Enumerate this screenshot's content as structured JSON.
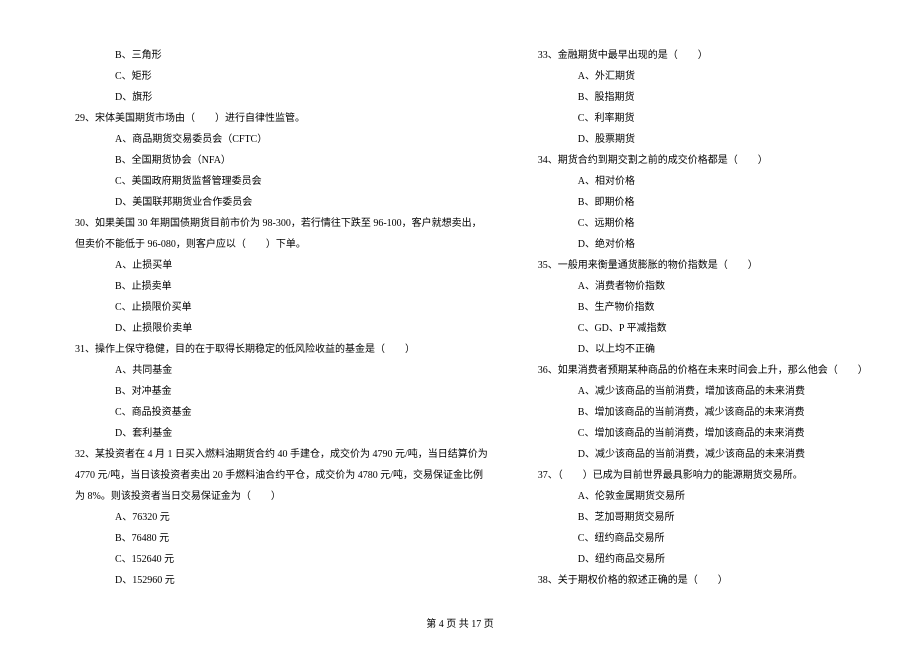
{
  "leftColumn": {
    "q28_options": [
      "B、三角形",
      "C、矩形",
      "D、旗形"
    ],
    "q29": {
      "text": "29、宋体美国期货市场由（　　）进行自律性监管。",
      "options": [
        "A、商品期货交易委员会（CFTC）",
        "B、全国期货协会（NFA）",
        "C、美国政府期货监督管理委员会",
        "D、美国联邦期货业合作委员会"
      ]
    },
    "q30": {
      "line1": "30、如果美国 30 年期国债期货目前市价为 98-300，若行情往下跌至 96-100，客户就想卖出，",
      "line2": "但卖价不能低于 96-080，则客户应以（　　）下单。",
      "options": [
        "A、止损买单",
        "B、止损卖单",
        "C、止损限价买单",
        "D、止损限价卖单"
      ]
    },
    "q31": {
      "text": "31、操作上保守稳健，目的在于取得长期稳定的低风险收益的基金是（　　）",
      "options": [
        "A、共同基金",
        "B、对冲基金",
        "C、商品投资基金",
        "D、套利基金"
      ]
    },
    "q32": {
      "line1": "32、某投资者在 4 月 1 日买入燃料油期货合约 40 手建仓，成交价为 4790 元/吨，当日结算价为",
      "line2": "4770 元/吨，当日该投资者卖出 20 手燃料油合约平仓，成交价为 4780 元/吨，交易保证金比例",
      "line3": "为 8%。则该投资者当日交易保证金为（　　）",
      "options": [
        "A、76320 元",
        "B、76480 元",
        "C、152640 元",
        "D、152960 元"
      ]
    }
  },
  "rightColumn": {
    "q33": {
      "text": "33、金融期货中最早出现的是（　　）",
      "options": [
        "A、外汇期货",
        "B、股指期货",
        "C、利率期货",
        "D、股票期货"
      ]
    },
    "q34": {
      "text": "34、期货合约到期交割之前的成交价格都是（　　）",
      "options": [
        "A、相对价格",
        "B、即期价格",
        "C、远期价格",
        "D、绝对价格"
      ]
    },
    "q35": {
      "text": "35、一般用来衡量通货膨胀的物价指数是（　　）",
      "options": [
        "A、消费者物价指数",
        "B、生产物价指数",
        "C、GD、P 平减指数",
        "D、以上均不正确"
      ]
    },
    "q36": {
      "text": "36、如果消费者预期某种商品的价格在未来时间会上升，那么他会（　　）",
      "options": [
        "A、减少该商品的当前消费，增加该商品的未来消费",
        "B、增加该商品的当前消费，减少该商品的未来消费",
        "C、增加该商品的当前消费，增加该商品的未来消费",
        "D、减少该商品的当前消费，减少该商品的未来消费"
      ]
    },
    "q37": {
      "text": "37、（　　）已成为目前世界最具影响力的能源期货交易所。",
      "options": [
        "A、伦敦金属期货交易所",
        "B、芝加哥期货交易所",
        "C、纽约商品交易所",
        "D、纽约商品交易所"
      ]
    },
    "q38": {
      "text": "38、关于期权价格的叙述正确的是（　　）"
    }
  },
  "footer": "第 4 页 共 17 页"
}
